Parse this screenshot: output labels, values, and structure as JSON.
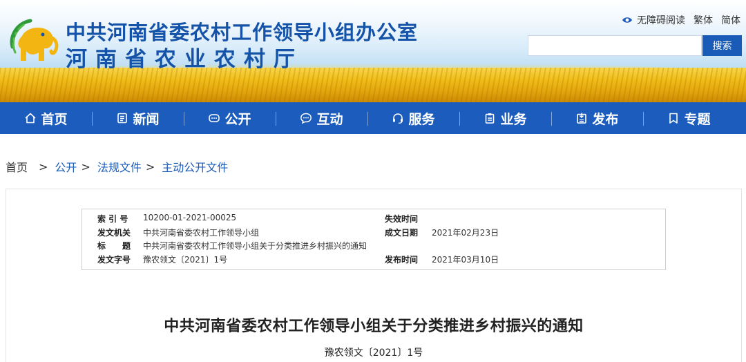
{
  "header": {
    "title_line1": "中共河南省委农村工作领导小组办公室",
    "title_line2": "河南省农业农村厅",
    "top_links": {
      "accessibility": "无障碍阅读",
      "traditional": "繁体",
      "simplified": "简体"
    },
    "search": {
      "placeholder": "",
      "button_label": "搜索"
    },
    "colors": {
      "brand_blue": "#1553a8",
      "nav_blue": "#1c5cbc"
    }
  },
  "nav": {
    "items": [
      {
        "label": "首页",
        "icon": "home-icon"
      },
      {
        "label": "新闻",
        "icon": "news-icon"
      },
      {
        "label": "公开",
        "icon": "chat-icon"
      },
      {
        "label": "互动",
        "icon": "speech-bubble-icon"
      },
      {
        "label": "服务",
        "icon": "headset-icon"
      },
      {
        "label": "业务",
        "icon": "clipboard-icon"
      },
      {
        "label": "发布",
        "icon": "publish-icon"
      },
      {
        "label": "专题",
        "icon": "bookmark-icon"
      }
    ]
  },
  "breadcrumb": {
    "home": "首页",
    "sep": ">",
    "level1": "公开",
    "level2": "法规文件",
    "level3": "主动公开文件"
  },
  "info": {
    "index_label": "索 引 号",
    "index_value": "10200-01-2021-00025",
    "invalid_label": "失效时间",
    "invalid_value": "",
    "issuer_label": "发文机关",
    "issuer_value": "中共河南省委农村工作领导小组",
    "created_label": "成文日期",
    "created_value": "2021年02月23日",
    "title_label": "标　　题",
    "title_value": "中共河南省委农村工作领导小组关于分类推进乡村振兴的通知",
    "docno_label": "发文字号",
    "docno_value": "豫农领文〔2021〕1号",
    "published_label": "发布时间",
    "published_value": "2021年03月10日"
  },
  "document": {
    "title": "中共河南省委农村工作领导小组关于分类推进乡村振兴的通知",
    "number": "豫农领文〔2021〕1号"
  }
}
